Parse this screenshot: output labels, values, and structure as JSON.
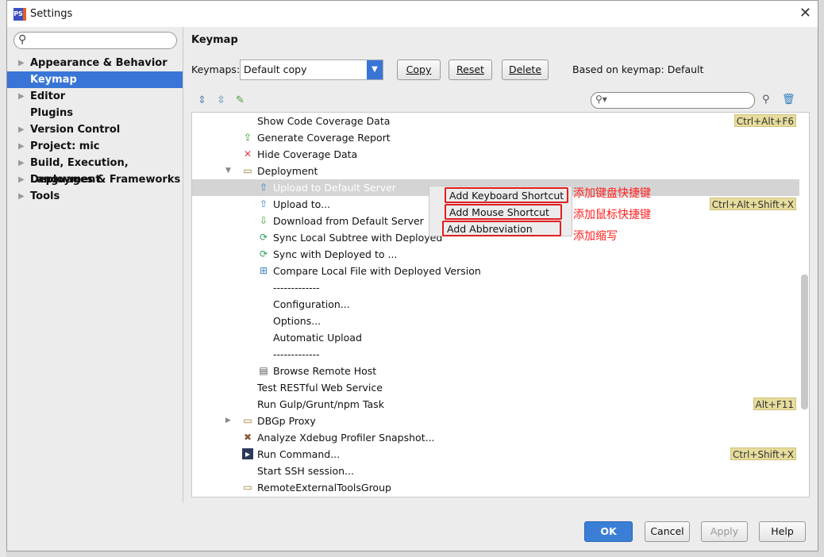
{
  "window": {
    "title": "Settings",
    "app_icon": "phpstorm-icon"
  },
  "sidebar": {
    "search_placeholder": "",
    "items": [
      {
        "label": "Appearance & Behavior",
        "expandable": true
      },
      {
        "label": "Keymap",
        "expandable": false,
        "selected": true
      },
      {
        "label": "Editor",
        "expandable": true
      },
      {
        "label": "Plugins",
        "expandable": false
      },
      {
        "label": "Version Control",
        "expandable": true
      },
      {
        "label": "Project: mic",
        "expandable": true
      },
      {
        "label": "Build, Execution, Deployment",
        "expandable": true
      },
      {
        "label": "Languages & Frameworks",
        "expandable": true
      },
      {
        "label": "Tools",
        "expandable": true
      }
    ]
  },
  "panel": {
    "title": "Keymap",
    "keymaps_label": "Keymaps:",
    "keymap_value": "Default copy",
    "copy": "Copy",
    "reset": "Reset",
    "delete": "Delete",
    "based_on": "Based on keymap: Default",
    "filter_value": ""
  },
  "tree": [
    {
      "label": "Show Code Coverage Data",
      "icon": "",
      "shortcut": "Ctrl+Alt+F6",
      "level": 1
    },
    {
      "label": "Generate Coverage Report",
      "icon": "export-icon",
      "level": 1
    },
    {
      "label": "Hide Coverage Data",
      "icon": "red-x-icon",
      "level": 1
    },
    {
      "label": "Deployment",
      "icon": "folder-icon",
      "level": 1,
      "expanded": true
    },
    {
      "label": "Upload to Default Server",
      "icon": "upload-icon",
      "level": 2,
      "highlighted": true
    },
    {
      "label": "Upload to...",
      "icon": "upload-icon",
      "shortcut": "Ctrl+Alt+Shift+X",
      "level": 2
    },
    {
      "label": "Download from Default Server",
      "icon": "download-icon",
      "level": 2
    },
    {
      "label": "Sync Local Subtree with Deployed",
      "icon": "sync-icon",
      "level": 2
    },
    {
      "label": "Sync with Deployed to ...",
      "icon": "sync-icon",
      "level": 2
    },
    {
      "label": "Compare Local File with Deployed Version",
      "icon": "compare-icon",
      "level": 2
    },
    {
      "label": "-------------",
      "icon": "",
      "level": 2
    },
    {
      "label": "Configuration...",
      "icon": "",
      "level": 2
    },
    {
      "label": "Options...",
      "icon": "",
      "level": 2
    },
    {
      "label": "Automatic Upload",
      "icon": "",
      "level": 2
    },
    {
      "label": "-------------",
      "icon": "",
      "level": 2
    },
    {
      "label": "Browse Remote Host",
      "icon": "server-icon",
      "level": 2
    },
    {
      "label": "Test RESTful Web Service",
      "icon": "",
      "level": 1
    },
    {
      "label": "Run Gulp/Grunt/npm Task",
      "icon": "",
      "shortcut": "Alt+F11",
      "level": 1
    },
    {
      "label": "DBGp Proxy",
      "icon": "folder-icon",
      "level": 1,
      "collapsed": true
    },
    {
      "label": "Analyze Xdebug Profiler Snapshot...",
      "icon": "xdebug-icon",
      "level": 1
    },
    {
      "label": "Run Command...",
      "icon": "terminal-icon",
      "shortcut": "Ctrl+Shift+X",
      "level": 1
    },
    {
      "label": "Start SSH session...",
      "icon": "",
      "level": 1
    },
    {
      "label": "RemoteExternalToolsGroup",
      "icon": "folder-icon",
      "level": 1
    }
  ],
  "context_menu": [
    "Add Keyboard Shortcut",
    "Add Mouse Shortcut",
    "Add Abbreviation"
  ],
  "annotations": [
    "添加键盘快捷键",
    "添加鼠标快捷键",
    "添加缩写"
  ],
  "footer": {
    "ok": "OK",
    "cancel": "Cancel",
    "apply": "Apply",
    "help": "Help"
  }
}
